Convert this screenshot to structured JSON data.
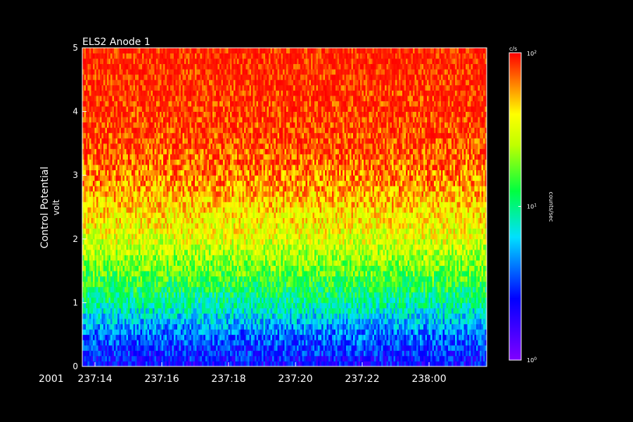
{
  "chart_data": {
    "type": "heatmap",
    "title": "ELS2 Anode 1",
    "year_label": "2001",
    "ylabel": "Control Potential",
    "yunit": "volt",
    "ylim": [
      0,
      5
    ],
    "yticks": [
      0,
      1,
      2,
      3,
      4,
      5
    ],
    "xticks": [
      "237:14",
      "237:16",
      "237:18",
      "237:20",
      "237:22",
      "238:00"
    ],
    "colorbar": {
      "top_label": "c/s",
      "title": "counts/sec",
      "scale": "log",
      "range": [
        1,
        100
      ],
      "ticks": [
        {
          "value": 100,
          "base": "10",
          "exp": "2"
        },
        {
          "value": 10,
          "base": "10",
          "exp": "1"
        },
        {
          "value": 1,
          "base": "10",
          "exp": "0"
        }
      ]
    },
    "log10_counts_profile": [
      {
        "voltage": 0.0,
        "log10_counts": 0.35
      },
      {
        "voltage": 0.5,
        "log10_counts": 0.6
      },
      {
        "voltage": 1.0,
        "log10_counts": 0.95
      },
      {
        "voltage": 1.5,
        "log10_counts": 1.25
      },
      {
        "voltage": 2.0,
        "log10_counts": 1.5
      },
      {
        "voltage": 2.5,
        "log10_counts": 1.65
      },
      {
        "voltage": 3.0,
        "log10_counts": 1.8
      },
      {
        "voltage": 3.5,
        "log10_counts": 1.9
      },
      {
        "voltage": 4.0,
        "log10_counts": 1.95
      },
      {
        "voltage": 5.0,
        "log10_counts": 2.0
      }
    ]
  }
}
